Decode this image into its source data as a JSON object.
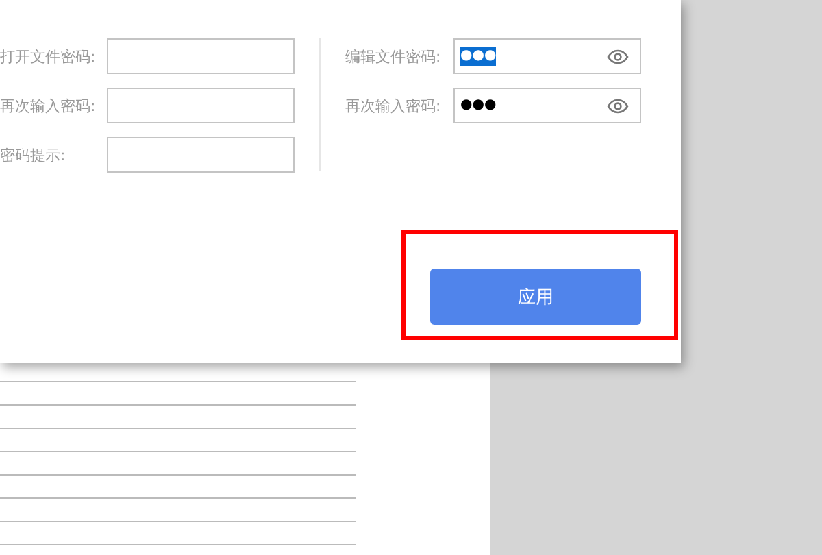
{
  "open_password": {
    "fields": [
      {
        "label": "打开文件密码:"
      },
      {
        "label": "再次输入密码:"
      },
      {
        "label": "密码提示:"
      }
    ]
  },
  "edit_password": {
    "fields": [
      {
        "label": "编辑文件密码:",
        "value": "●●●",
        "selected": true
      },
      {
        "label": "再次输入密码:",
        "value": "●●●",
        "selected": false
      }
    ]
  },
  "apply_button": {
    "label": "应用",
    "highlighted": true
  }
}
